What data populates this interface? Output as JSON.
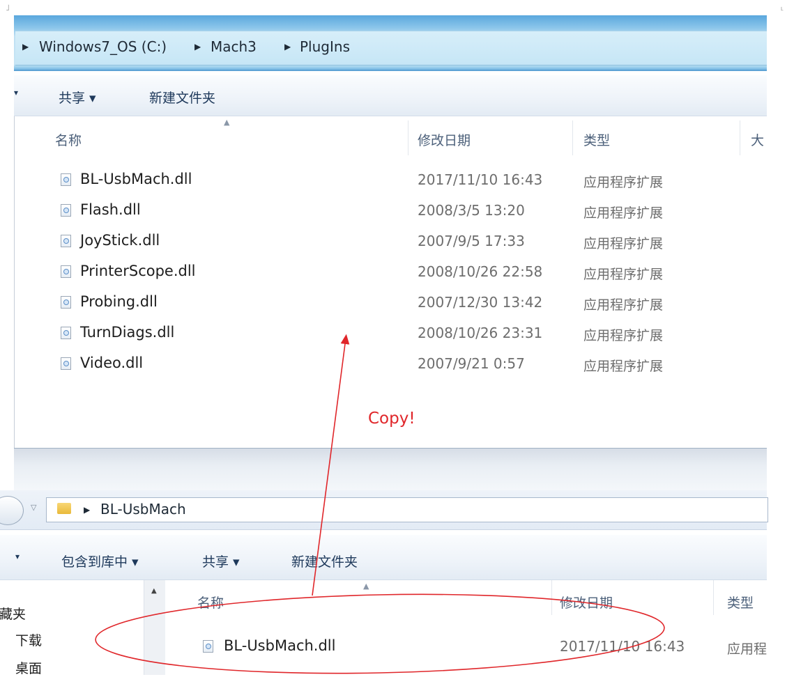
{
  "top_window": {
    "breadcrumb": [
      "Windows7_OS (C:)",
      "Mach3",
      "PlugIns"
    ],
    "toolbar": {
      "share_label": "共享 ▾",
      "new_folder_label": "新建文件夹"
    },
    "columns": {
      "name": "名称",
      "date": "修改日期",
      "type": "类型",
      "size": "大"
    },
    "files": [
      {
        "name": "BL-UsbMach.dll",
        "date": "2017/11/10 16:43",
        "type": "应用程序扩展"
      },
      {
        "name": "Flash.dll",
        "date": "2008/3/5 13:20",
        "type": "应用程序扩展"
      },
      {
        "name": "JoyStick.dll",
        "date": "2007/9/5 17:33",
        "type": "应用程序扩展"
      },
      {
        "name": "PrinterScope.dll",
        "date": "2008/10/26 22:58",
        "type": "应用程序扩展"
      },
      {
        "name": "Probing.dll",
        "date": "2007/12/30 13:42",
        "type": "应用程序扩展"
      },
      {
        "name": "TurnDiags.dll",
        "date": "2008/10/26 23:31",
        "type": "应用程序扩展"
      },
      {
        "name": "Video.dll",
        "date": "2007/9/21 0:57",
        "type": "应用程序扩展"
      }
    ]
  },
  "annotation": {
    "copy_label": "Copy!",
    "color": "#e0262a"
  },
  "bottom_window": {
    "breadcrumb": [
      "BL-UsbMach"
    ],
    "toolbar": {
      "include_library_label": "包含到库中 ▾",
      "share_label": "共享 ▾",
      "new_folder_label": "新建文件夹"
    },
    "nav_pane": [
      "收藏夹",
      "下载",
      "桌面"
    ],
    "columns": {
      "name": "名称",
      "date": "修改日期",
      "type": "类型"
    },
    "files": [
      {
        "name": "BL-UsbMach.dll",
        "date": "2017/11/10 16:43",
        "type": "应用程"
      }
    ]
  }
}
